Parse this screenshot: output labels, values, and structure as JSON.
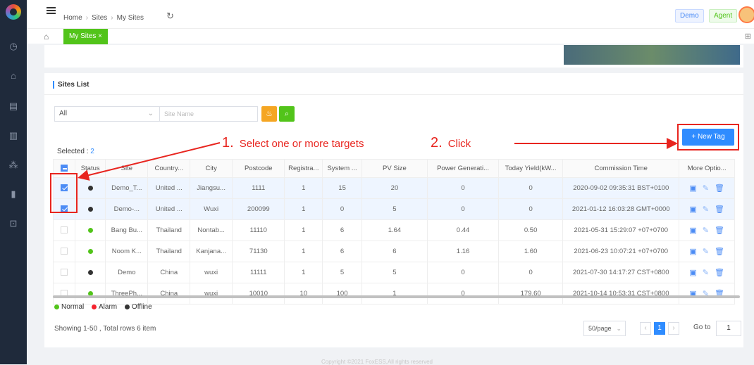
{
  "sidebar": {
    "icons": [
      "logo-icon",
      "clock-icon",
      "home-icon",
      "list-icon",
      "document-icon",
      "network-icon",
      "chart-icon",
      "lock-icon"
    ]
  },
  "header": {
    "breadcrumb": [
      "Home",
      "Sites",
      "My Sites"
    ],
    "demo_label": "Demo",
    "agent_label": "Agent"
  },
  "tabs": {
    "active": "My Sites ×"
  },
  "card": {
    "title": "Sites List",
    "filter_value": "All",
    "site_name_placeholder": "Site Name",
    "selected_label": "Selected : ",
    "selected_count": "2",
    "new_tag_label": "+ New Tag"
  },
  "annotations": {
    "step1_num": "1.",
    "step1_text": "Select one or more targets",
    "step2_num": "2.",
    "step2_text": "Click"
  },
  "table": {
    "headers": [
      "",
      "Status",
      "Site",
      "Country...",
      "City",
      "Postcode",
      "Registra...",
      "System ...",
      "PV Size",
      "Power Generati...",
      "Today Yield(kW...",
      "Commission Time",
      "More Optio..."
    ],
    "rows": [
      {
        "checked": true,
        "status": "offline",
        "site": "Demo_T...",
        "country": "United ...",
        "city": "Jiangsu...",
        "postcode": "1111",
        "registra": "1",
        "system": "15",
        "pv": "20",
        "power": "0",
        "yield": "0",
        "time": "2020-09-02 09:35:31 BST+0100"
      },
      {
        "checked": true,
        "status": "offline",
        "site": "Demo-...",
        "country": "United ...",
        "city": "Wuxi",
        "postcode": "200099",
        "registra": "1",
        "system": "0",
        "pv": "5",
        "power": "0",
        "yield": "0",
        "time": "2021-01-12 16:03:28 GMT+0000"
      },
      {
        "checked": false,
        "status": "normal",
        "site": "Bang Bu...",
        "country": "Thailand",
        "city": "Nontab...",
        "postcode": "11110",
        "registra": "1",
        "system": "6",
        "pv": "1.64",
        "power": "0.44",
        "yield": "0.50",
        "time": "2021-05-31 15:29:07 +07+0700"
      },
      {
        "checked": false,
        "status": "normal",
        "site": "Noom K...",
        "country": "Thailand",
        "city": "Kanjana...",
        "postcode": "71130",
        "registra": "1",
        "system": "6",
        "pv": "6",
        "power": "1.16",
        "yield": "1.60",
        "time": "2021-06-23 10:07:21 +07+0700"
      },
      {
        "checked": false,
        "status": "offline",
        "site": "Demo",
        "country": "China",
        "city": "wuxi",
        "postcode": "11111",
        "registra": "1",
        "system": "5",
        "pv": "5",
        "power": "0",
        "yield": "0",
        "time": "2021-07-30 14:17:27 CST+0800"
      },
      {
        "checked": false,
        "status": "normal",
        "site": "ThreePh...",
        "country": "China",
        "city": "wuxi",
        "postcode": "10010",
        "registra": "10",
        "system": "100",
        "pv": "1",
        "power": "0",
        "yield": "179.60",
        "time": "2021-10-14 10:53:31 CST+0800"
      }
    ]
  },
  "legend": {
    "normal": "Normal",
    "alarm": "Alarm",
    "offline": "Offline"
  },
  "colors": {
    "normal": "#52c41a",
    "alarm": "#f5222d",
    "offline": "#333333",
    "accent": "#2f8cff",
    "annotation": "#e8251f"
  },
  "footer": {
    "showing": "Showing 1-50 , Total rows 6 item",
    "page_size": "50/page",
    "current_page": "1",
    "goto_label": "Go to",
    "goto_value": "1",
    "copyright": "Copyright ©2021 FoxESS,All rights reserved"
  }
}
